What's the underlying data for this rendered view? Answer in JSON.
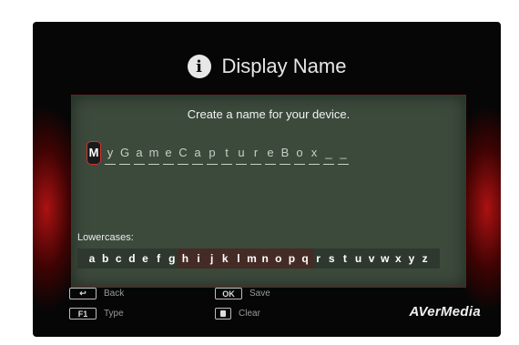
{
  "title": "Display Name",
  "prompt": "Create a name for your device.",
  "name_chars": [
    "M",
    "y",
    "G",
    "a",
    "m",
    "e",
    "C",
    "a",
    "p",
    "t",
    "u",
    "r",
    "e",
    "B",
    "o",
    "x",
    "_",
    "_"
  ],
  "input_mode_label": "Lowercases:",
  "keyboard_keys": [
    "a",
    "b",
    "c",
    "d",
    "e",
    "f",
    "g",
    "h",
    "i",
    "j",
    "k",
    "l",
    "m",
    "n",
    "o",
    "p",
    "q",
    "r",
    "s",
    "t",
    "u",
    "v",
    "w",
    "x",
    "y",
    "z"
  ],
  "hints": {
    "back": {
      "key": "↩",
      "label": "Back"
    },
    "type": {
      "key": "F1",
      "label": "Type"
    },
    "save": {
      "key": "OK",
      "label": "Save"
    },
    "clear": {
      "key": "trash",
      "label": "Clear"
    }
  },
  "brand": "AVerMedia",
  "colors": {
    "panel": "#3c4a3c",
    "accent_red": "#d23030",
    "background": "#060606"
  }
}
